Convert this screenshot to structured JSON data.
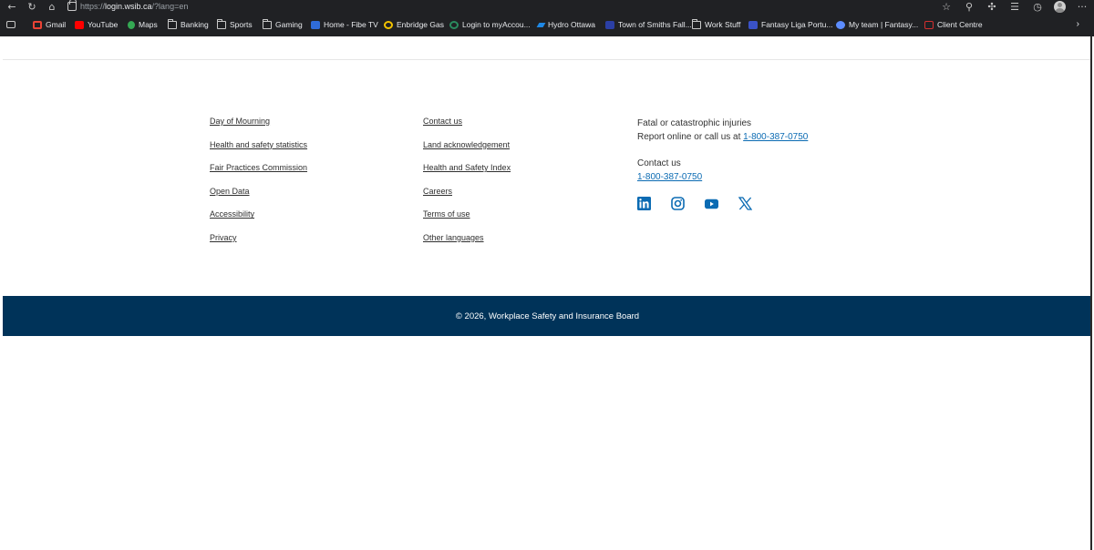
{
  "browser": {
    "url_prefix": "https://",
    "url_host": "login.wsib.ca",
    "url_path": "/?lang=en",
    "icons": [
      "back-arrow-icon",
      "refresh-icon",
      "home-icon",
      "lock-icon",
      "star-icon",
      "extensions-icon",
      "puzzle-icon",
      "favorites-icon",
      "history-icon",
      "profile-avatar",
      "more-icon"
    ],
    "more_label": "···"
  },
  "bookmarks": [
    {
      "label": "Gmail",
      "icon": "gmail-icon",
      "color": "#ea4335"
    },
    {
      "label": "YouTube",
      "icon": "youtube-icon",
      "color": "#ff0000"
    },
    {
      "label": "Maps",
      "icon": "maps-pin-icon",
      "color": "#34a853"
    },
    {
      "label": "Banking",
      "icon": "folder-icon"
    },
    {
      "label": "Sports",
      "icon": "folder-icon"
    },
    {
      "label": "Gaming",
      "icon": "folder-icon"
    },
    {
      "label": "Home - Fibe TV",
      "icon": "fibe-tv-icon",
      "color": "#2f6bd8"
    },
    {
      "label": "Enbridge Gas",
      "icon": "enbridge-icon",
      "color": "#f3c300"
    },
    {
      "label": "Login to myAccou...",
      "icon": "account-icon",
      "color": "#2a8b5f"
    },
    {
      "label": "Hydro Ottawa",
      "icon": "hydro-icon",
      "color": "#1e88e5"
    },
    {
      "label": "Town of Smiths Fall...",
      "icon": "town-icon",
      "color": "#2b3fa5"
    },
    {
      "label": "Work Stuff",
      "icon": "folder-icon"
    },
    {
      "label": "Fantasy Liga Portu...",
      "icon": "fantasy-liga-icon",
      "color": "#3a52c8"
    },
    {
      "label": "My team | Fantasy...",
      "icon": "fantasy-team-icon",
      "color": "#5c8cff"
    },
    {
      "label": "Client Centre",
      "icon": "client-centre-icon",
      "color": "#d32f2f"
    }
  ],
  "bookmarks_more": "›",
  "footer": {
    "col1": [
      "Day of Mourning",
      "Health and safety statistics",
      "Fair Practices Commission",
      "Open Data",
      "Accessibility",
      "Privacy"
    ],
    "col2": [
      "Contact us",
      "Land acknowledgement",
      "Health and Safety Index",
      "Careers",
      "Terms of use",
      "Other languages"
    ],
    "fatal_heading": "Fatal or catastrophic injuries",
    "fatal_prefix": "Report online or call us at ",
    "fatal_phone": "1-800-387-0750",
    "contact_heading": "Contact us",
    "contact_phone": "1-800-387-0750",
    "social": [
      "linkedin-icon",
      "instagram-icon",
      "youtube-icon",
      "x-icon"
    ],
    "social_color": "#0b6bb3",
    "copyright": "© 2026, Workplace Safety and Insurance Board",
    "copyright_bg": "#003359"
  }
}
